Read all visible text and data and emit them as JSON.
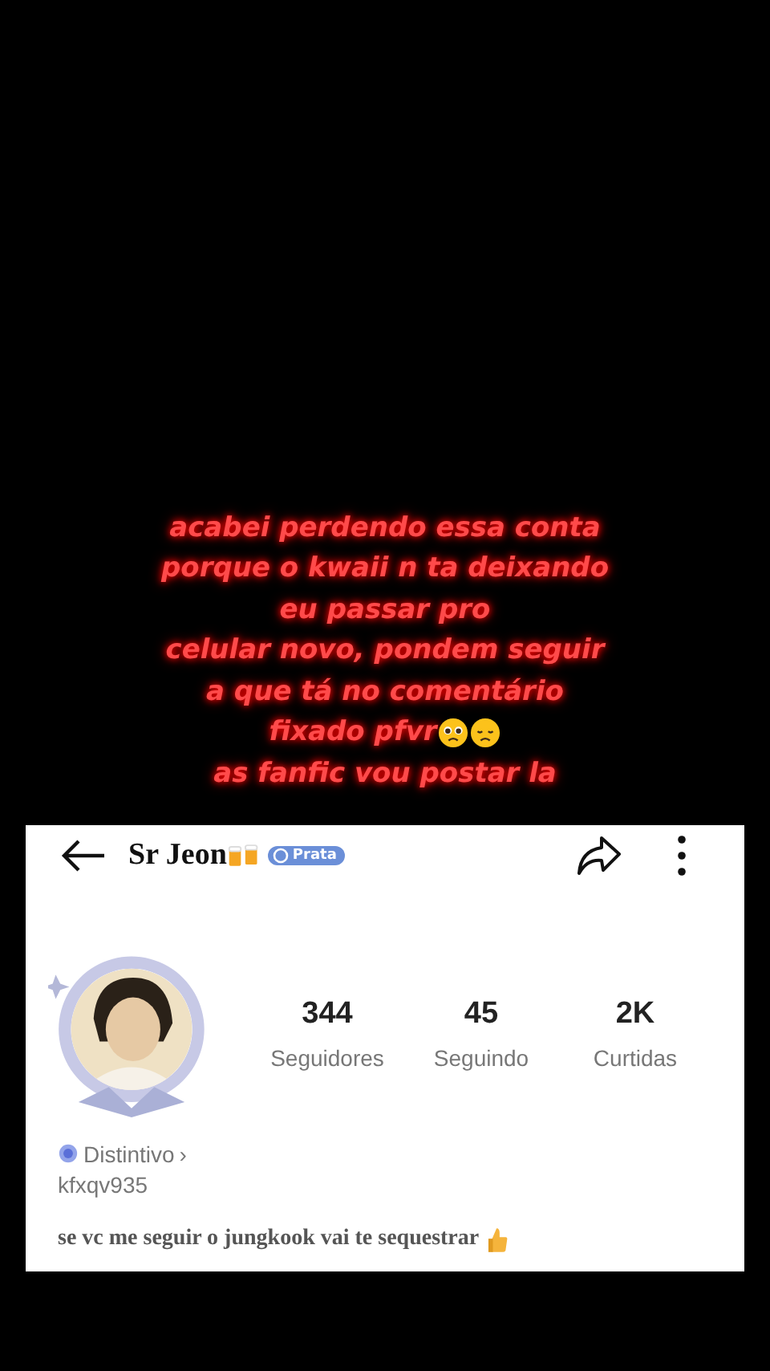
{
  "caption": {
    "lines": [
      "acabei perdendo essa conta",
      "porque o kwaii n ta deixando",
      "eu passar pro",
      "celular novo, pondem seguir",
      "a que tá no comentário",
      "fixado pfvr",
      "as fanfic vou postar la"
    ]
  },
  "profile": {
    "name": "Sr Jeon",
    "badge": "Prata",
    "stats": [
      {
        "value": "344",
        "label": "Seguidores"
      },
      {
        "value": "45",
        "label": "Seguindo"
      },
      {
        "value": "2K",
        "label": "Curtidas"
      }
    ],
    "distinctive": "Distintivo",
    "distinctive_arrow": "›",
    "user_id": "kfxqv935",
    "bio": "se vc me seguir o jungkook vai te sequestrar"
  }
}
